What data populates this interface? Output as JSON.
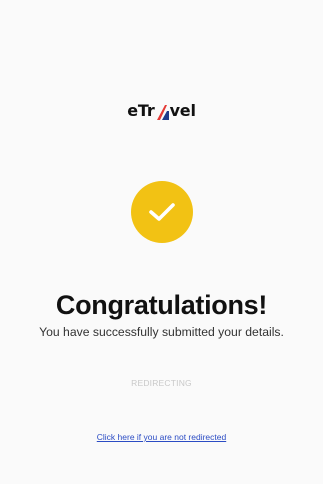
{
  "brand": {
    "logo_prefix": "eTr",
    "logo_suffix": "vel",
    "mark_colors": [
      "#e53935",
      "#1e3a8a"
    ]
  },
  "status": {
    "icon": "check-icon",
    "circle_color": "#f2c214"
  },
  "content": {
    "title": "Congratulations!",
    "subtitle": "You have successfully submitted your details.",
    "redirecting": "REDIRECTING",
    "redirect_link": "Click here if you are not redirected"
  }
}
